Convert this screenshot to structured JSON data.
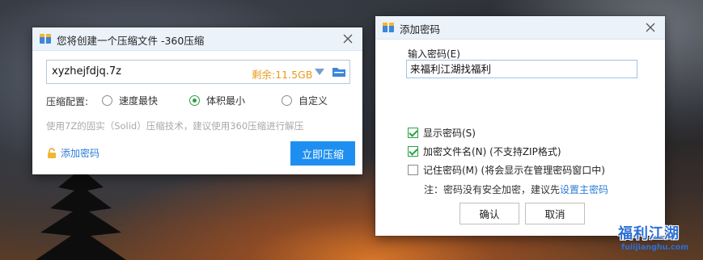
{
  "compress_window": {
    "title": "您将创建一个压缩文件 -360压缩",
    "file_name": "xyzhejfdjq.7z",
    "space_left": "剩余:11.5GB",
    "config_label": "压缩配置:",
    "options": [
      "速度最快",
      "体积最小",
      "自定义"
    ],
    "selected_option": "体积最小",
    "hint": "使用7Z的固实（Solid）压缩技术，建议使用360压缩进行解压",
    "add_password_link": "添加密码",
    "compress_button": "立即压缩"
  },
  "password_window": {
    "title": "添加密码",
    "input_label": "输入密码(E)",
    "password_value": "来福利江湖找福利",
    "checkboxes": [
      {
        "label": "显示密码(S)",
        "checked": true
      },
      {
        "label": "加密文件名(N) (不支持ZIP格式)",
        "checked": true
      },
      {
        "label": "记住密码(M) (将会显示在管理密码窗口中)",
        "checked": false
      }
    ],
    "note_prefix": "注：密码没有安全加密，建议先",
    "note_link": "设置主密码",
    "ok_button": "确认",
    "cancel_button": "取消"
  },
  "watermark": {
    "name": "福利江湖",
    "url": "fulijianghu.com"
  },
  "colors": {
    "accent_blue": "#1e8ff0",
    "link_blue": "#2b7bd6",
    "space_orange": "#e89b1c",
    "check_green": "#2aa044"
  }
}
